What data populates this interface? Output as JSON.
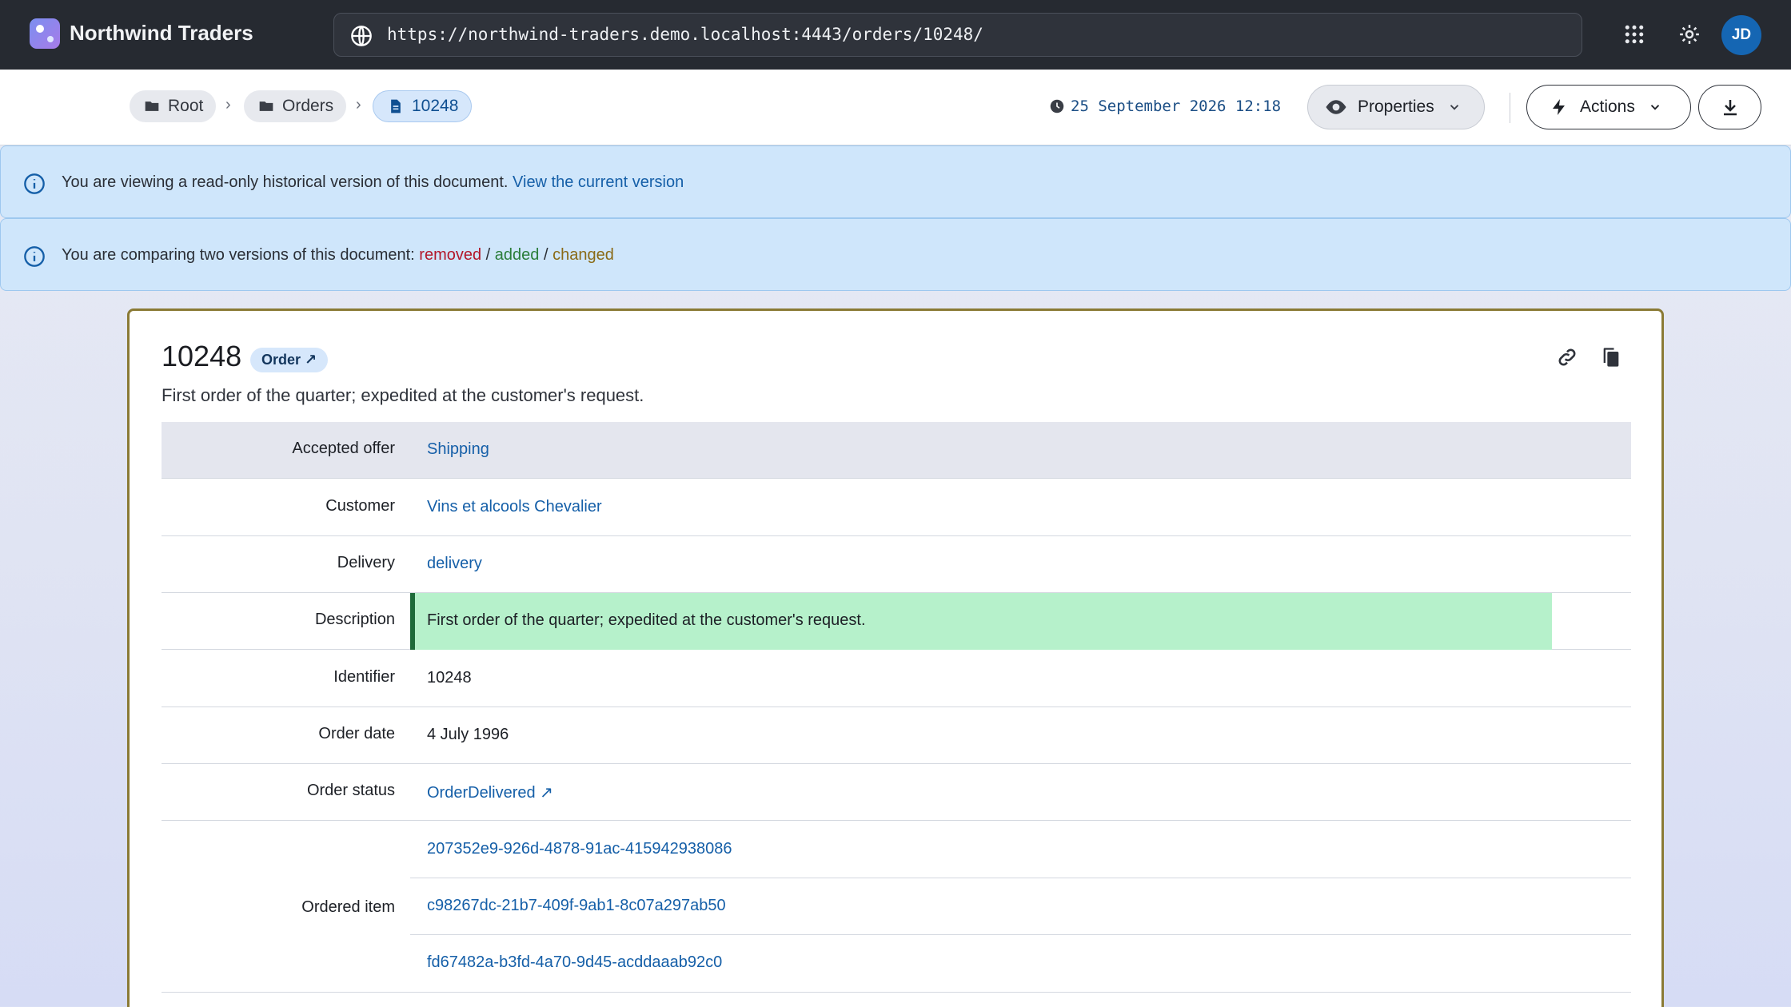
{
  "app": {
    "name": "Northwind Traders"
  },
  "browser": {
    "url": "https://northwind-traders.demo.localhost:4443/orders/10248/"
  },
  "user": {
    "initials": "JD"
  },
  "breadcrumb": {
    "items": [
      {
        "label": "Root",
        "icon": "folder-icon"
      },
      {
        "label": "Orders",
        "icon": "folder-icon"
      },
      {
        "label": "10248",
        "icon": "document-icon"
      }
    ],
    "separator": "›"
  },
  "toolbar": {
    "timestamp": "25 September 2026 12:18",
    "properties_label": "Properties",
    "actions_label": "Actions"
  },
  "alerts": {
    "readonly": {
      "text": "You are viewing a read-only historical version of this document.",
      "link": "View the current version"
    },
    "compare": {
      "text": "You are comparing two versions of this document:",
      "removed": "removed",
      "added": "added",
      "changed": "changed",
      "sep": "/"
    }
  },
  "document": {
    "title": "10248",
    "type_label": "Order ↗",
    "description": "First order of the quarter; expedited at the customer's request.",
    "properties": [
      {
        "label": "Accepted offer",
        "value": "Shipping",
        "link": true
      },
      {
        "label": "Customer",
        "value": "Vins et alcools Chevalier",
        "link": true
      },
      {
        "label": "Delivery",
        "value": "delivery",
        "link": true
      },
      {
        "label": "Description",
        "value": "First order of the quarter; expedited at the customer's request.",
        "diff": "added"
      },
      {
        "label": "Identifier",
        "value": "10248"
      },
      {
        "label": "Order date",
        "value": "4 July 1996"
      },
      {
        "label": "Order status",
        "value": "OrderDelivered ↗",
        "link": true
      }
    ],
    "ordered_item": {
      "label": "Ordered item",
      "values": [
        "207352e9-926d-4878-91ac-415942938086",
        "c98267dc-21b7-409f-9ab1-8c07a297ab50",
        "fd67482a-b3fd-4a70-9d45-acddaaab92c0"
      ]
    }
  },
  "colors": {
    "topbar": "#262a31",
    "accent": "#1566b3",
    "diff_added_bg": "#b6f1cb",
    "diff_removed": "#b3172a",
    "card_border": "#8a7a35"
  }
}
